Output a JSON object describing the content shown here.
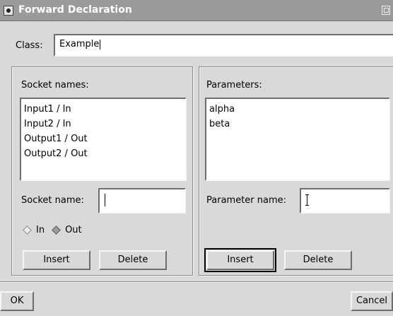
{
  "window": {
    "title": "Forward Declaration"
  },
  "class_row": {
    "label": "Class:",
    "value": "Example"
  },
  "sockets": {
    "heading": "Socket names:",
    "items": [
      "Input1 / In",
      "Input2 / In",
      "Output1 / Out",
      "Output2 / Out"
    ],
    "name_label": "Socket name:",
    "name_value": "",
    "direction": {
      "options": [
        {
          "label": "In",
          "selected": false
        },
        {
          "label": "Out",
          "selected": true
        }
      ]
    },
    "insert_label": "Insert",
    "delete_label": "Delete"
  },
  "parameters": {
    "heading": "Parameters:",
    "items": [
      "alpha",
      "beta"
    ],
    "name_label": "Parameter name:",
    "name_value": "",
    "insert_label": "Insert",
    "delete_label": "Delete"
  },
  "footer": {
    "ok_label": "OK",
    "cancel_label": "Cancel"
  }
}
